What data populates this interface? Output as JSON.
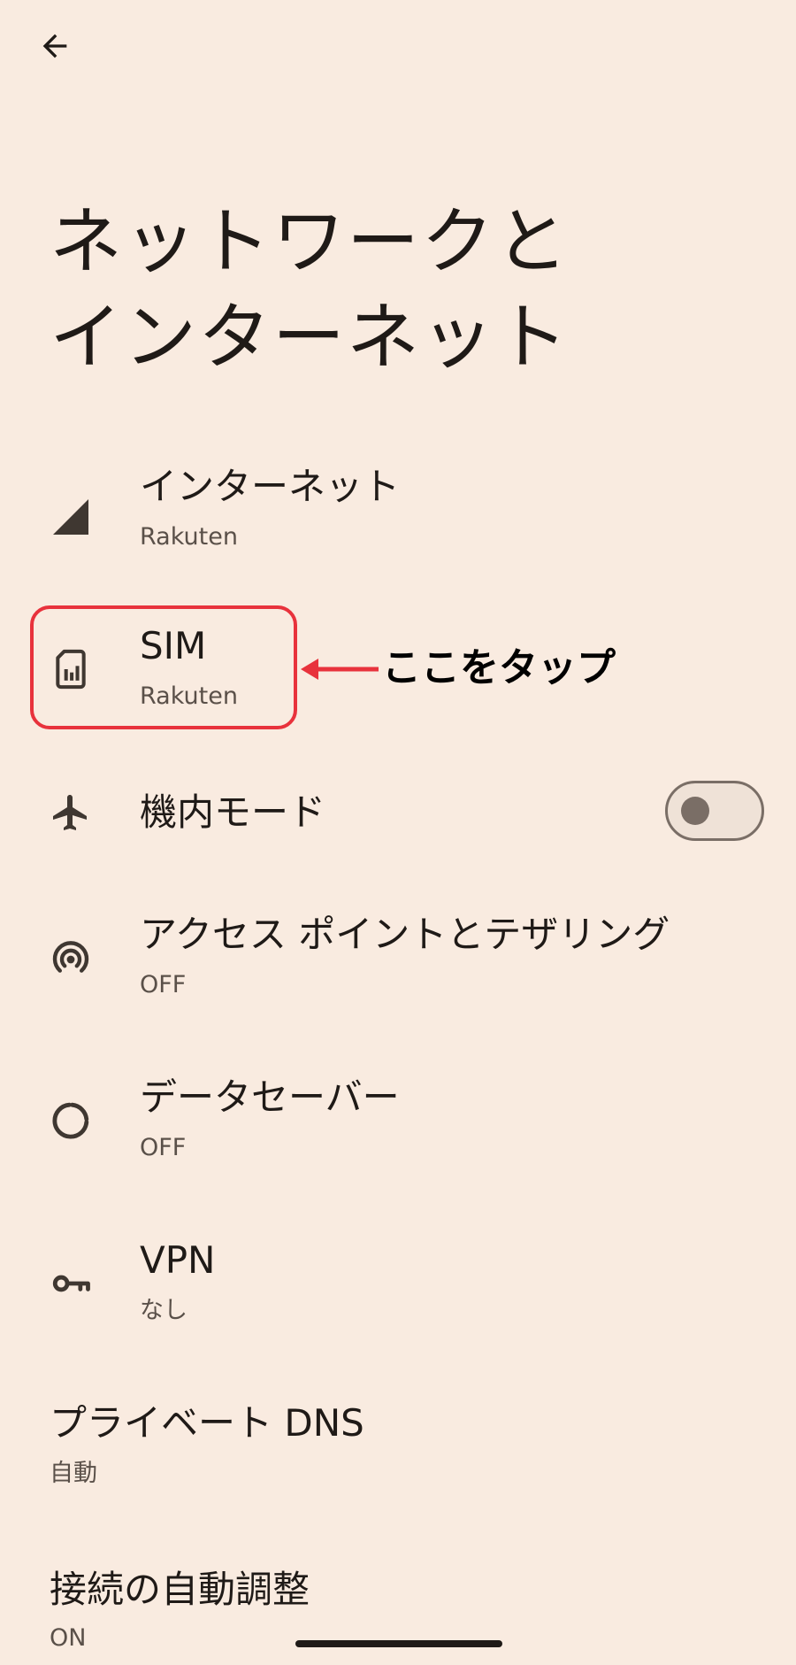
{
  "header": {
    "back_icon": "arrow-left-icon"
  },
  "page": {
    "title_line1": "ネットワークと",
    "title_line2": "インターネット"
  },
  "items": [
    {
      "key": "internet",
      "icon": "signal-icon",
      "title": "インターネット",
      "subtitle": "Rakuten"
    },
    {
      "key": "sim",
      "icon": "sim-card-icon",
      "title": "SIM",
      "subtitle": "Rakuten"
    },
    {
      "key": "airplane",
      "icon": "airplane-icon",
      "title": "機内モード",
      "toggle_on": false
    },
    {
      "key": "hotspot",
      "icon": "hotspot-icon",
      "title": "アクセス ポイントとテザリング",
      "subtitle": "OFF"
    },
    {
      "key": "datasaver",
      "icon": "data-saver-icon",
      "title": "データセーバー",
      "subtitle": "OFF"
    },
    {
      "key": "vpn",
      "icon": "vpn-key-icon",
      "title": "VPN",
      "subtitle": "なし"
    },
    {
      "key": "privatedns",
      "title": "プライベート DNS",
      "subtitle": "自動"
    },
    {
      "key": "adaptive",
      "title": "接続の自動調整",
      "subtitle": "ON"
    }
  ],
  "annotation": {
    "label": "ここをタップ",
    "color": "#e8323c"
  },
  "colors": {
    "background": "#f9ebe0",
    "text": "#1f1a17",
    "subtext": "#5a5049",
    "icon": "#3f3731",
    "highlight": "#e8323c"
  }
}
